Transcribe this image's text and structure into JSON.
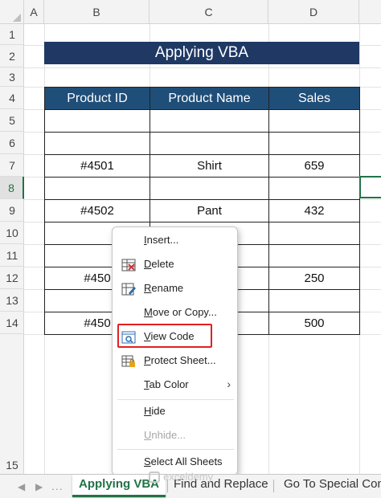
{
  "columns": [
    "A",
    "B",
    "C",
    "D"
  ],
  "rows": [
    "1",
    "2",
    "3",
    "4",
    "5",
    "6",
    "7",
    "8",
    "9",
    "10",
    "11",
    "12",
    "13",
    "14",
    "15"
  ],
  "title": "Applying VBA",
  "table": {
    "headers": [
      "Product ID",
      "Product Name",
      "Sales"
    ],
    "rows": [
      [
        "",
        "",
        ""
      ],
      [
        "",
        "",
        ""
      ],
      [
        "#4501",
        "Shirt",
        "659"
      ],
      [
        "",
        "",
        ""
      ],
      [
        "#4502",
        "Pant",
        "432"
      ],
      [
        "",
        "",
        ""
      ],
      [
        "",
        "",
        ""
      ],
      [
        "#450",
        "",
        "250"
      ],
      [
        "",
        "",
        ""
      ],
      [
        "#450",
        "",
        "500"
      ]
    ]
  },
  "context_menu": {
    "items": [
      {
        "label_pre": "",
        "label_u": "I",
        "label_post": "nsert...",
        "icon": ""
      },
      {
        "label_pre": "",
        "label_u": "D",
        "label_post": "elete",
        "icon": "delete-sheet-icon"
      },
      {
        "label_pre": "",
        "label_u": "R",
        "label_post": "ename",
        "icon": "rename-sheet-icon"
      },
      {
        "label_pre": "",
        "label_u": "M",
        "label_post": "ove or Copy...",
        "icon": ""
      },
      {
        "label_pre": "",
        "label_u": "V",
        "label_post": "iew Code",
        "icon": "view-code-icon"
      },
      {
        "label_pre": "",
        "label_u": "P",
        "label_post": "rotect Sheet...",
        "icon": "protect-sheet-icon"
      },
      {
        "label_pre": "",
        "label_u": "T",
        "label_post": "ab Color",
        "icon": ""
      },
      {
        "label_pre": "",
        "label_u": "H",
        "label_post": "ide",
        "icon": ""
      },
      {
        "label_pre": "",
        "label_u": "U",
        "label_post": "nhide...",
        "icon": ""
      },
      {
        "label_pre": "",
        "label_u": "S",
        "label_post": "elect All Sheets",
        "icon": ""
      }
    ],
    "submenu_arrow": "›"
  },
  "sheet_tabs": [
    "Applying VBA",
    "Find and Replace",
    "Go To Special Com"
  ],
  "tab_nav": {
    "prev": "◀",
    "next": "▶",
    "more": "..."
  },
  "watermark": "exceldemy",
  "colors": {
    "banner": "#1f3864",
    "header": "#1f4e79",
    "excel_green": "#217346",
    "highlight": "#e02020"
  }
}
